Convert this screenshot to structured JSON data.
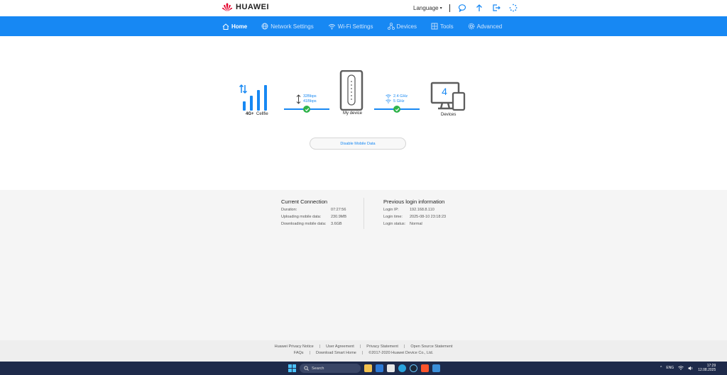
{
  "header": {
    "brand": "HUAWEI",
    "language_label": "Language"
  },
  "nav": {
    "items": [
      {
        "label": "Home",
        "icon": "home-icon"
      },
      {
        "label": "Network Settings",
        "icon": "globe-icon"
      },
      {
        "label": "Wi-Fi Settings",
        "icon": "wifi-icon"
      },
      {
        "label": "Devices",
        "icon": "devices-icon"
      },
      {
        "label": "Tools",
        "icon": "tools-icon"
      },
      {
        "label": "Advanced",
        "icon": "gear-icon"
      }
    ],
    "active": "Home"
  },
  "status": {
    "network_type": "4G+",
    "carrier": "Cellfie",
    "upload_speed": "32Bbps",
    "download_speed": "41Bbps",
    "device_label": "My device",
    "wifi_band_1": "2.4 GHz",
    "wifi_band_2": "5 GHz",
    "device_count": "4",
    "devices_label": "Devices"
  },
  "actions": {
    "disable_mobile_data": "Disable Mobile Data"
  },
  "current_connection": {
    "title": "Current Connection",
    "rows": [
      {
        "label": "Duration:",
        "value": "07:27:56"
      },
      {
        "label": "Uploading mobile data:",
        "value": "230.9MB"
      },
      {
        "label": "Downloading mobile data:",
        "value": "3.6GB"
      }
    ]
  },
  "previous_login": {
    "title": "Previous login information",
    "rows": [
      {
        "label": "Login IP:",
        "value": "192.168.8.110"
      },
      {
        "label": "Login time:",
        "value": "2025-08-10 23:18:23"
      },
      {
        "label": "Login status:",
        "value": "Normal"
      }
    ]
  },
  "footer": {
    "links_row1": [
      "Huawei Privacy Notice",
      "User Agreement",
      "Privacy Statement",
      "Open Source Statement"
    ],
    "links_row2": [
      "FAQs",
      "Download Smart Home"
    ],
    "copyright": "©2017-2020 Huawei Device Co., Ltd."
  },
  "taskbar": {
    "search_label": "Search",
    "language": "ENG",
    "time": "17:29",
    "date": "12.08.2025"
  },
  "colors": {
    "accent": "#1788f3",
    "check": "#2fb34a",
    "brand_red": "#e4002b"
  }
}
